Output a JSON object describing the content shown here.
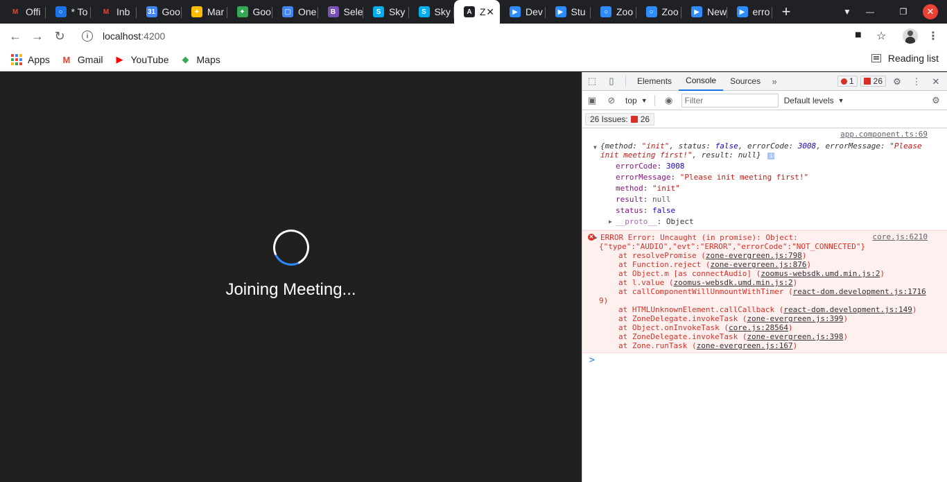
{
  "browser": {
    "tabs": [
      {
        "label": "Offi",
        "icon": "gmail-icon",
        "color": "#ea4335",
        "glyph": "M"
      },
      {
        "label": "* To",
        "icon": "todo-icon",
        "color": "#1a73e8",
        "glyph": "○"
      },
      {
        "label": "Inb",
        "icon": "gmail-icon",
        "color": "#ea4335",
        "glyph": "M"
      },
      {
        "label": "Goo",
        "icon": "calendar-icon",
        "color": "#4285f4",
        "glyph": "31"
      },
      {
        "label": "Mar",
        "icon": "google-photos-icon",
        "color": "#fbbc04",
        "glyph": "✦"
      },
      {
        "label": "Goo",
        "icon": "google-photos-icon",
        "color": "#34a853",
        "glyph": "✦"
      },
      {
        "label": "One",
        "icon": "onedrive-icon",
        "color": "#4285f4",
        "glyph": "▢"
      },
      {
        "label": "Sele",
        "icon": "bootstrap-icon",
        "color": "#7952b3",
        "glyph": "B"
      },
      {
        "label": "Sky",
        "icon": "skype-icon",
        "color": "#00aff0",
        "glyph": "S"
      },
      {
        "label": "Sky",
        "icon": "skype-icon",
        "color": "#00aff0",
        "glyph": "S"
      },
      {
        "label": "Z",
        "icon": "angular-icon",
        "color": "#dd0031",
        "glyph": "A",
        "active": true
      },
      {
        "label": "Dev",
        "icon": "zoom-icon",
        "color": "#2d8cff",
        "glyph": "▶"
      },
      {
        "label": "Stu",
        "icon": "zoom-icon",
        "color": "#2d8cff",
        "glyph": "▶"
      },
      {
        "label": "Zoo",
        "icon": "zoom-round-icon",
        "color": "#2d8cff",
        "glyph": "○"
      },
      {
        "label": "Zoo",
        "icon": "zoom-round-icon",
        "color": "#2d8cff",
        "glyph": "○"
      },
      {
        "label": "New",
        "icon": "zoom-icon",
        "color": "#2d8cff",
        "glyph": "▶"
      },
      {
        "label": "erro",
        "icon": "zoom-icon",
        "color": "#2d8cff",
        "glyph": "▶"
      }
    ],
    "newtab": "+",
    "url_host": "localhost",
    "url_port": ":4200",
    "bookmarks": [
      {
        "label": "Apps",
        "icon": "apps-grid-icon"
      },
      {
        "label": "Gmail",
        "icon": "gmail-icon",
        "glyph": "M",
        "color": "#ea4335"
      },
      {
        "label": "YouTube",
        "icon": "youtube-icon",
        "glyph": "▶",
        "color": "#ff0000"
      },
      {
        "label": "Maps",
        "icon": "maps-icon",
        "glyph": "◆",
        "color": "#34a853"
      }
    ],
    "reading_list": "Reading list"
  },
  "page": {
    "loading_text": "Joining Meeting..."
  },
  "devtools": {
    "tabs": [
      "Elements",
      "Console",
      "Sources"
    ],
    "active_tab": "Console",
    "error_count": "1",
    "issue_count": "26",
    "context": "top",
    "filter_placeholder": "Filter",
    "levels": "Default levels",
    "issues_label": "26 Issues:",
    "issues_count": "26",
    "log": {
      "source": "app.component.ts:69",
      "summary_open": "{method: ",
      "summary_method": "\"init\"",
      "summary_status_key": ", status: ",
      "summary_status": "false",
      "summary_code_key": ", errorCode: ",
      "summary_code": "3008",
      "summary_msg_key": ", errorMessage: ",
      "summary_msg": "\"Please init meeting first!\"",
      "summary_result_key": ", result: ",
      "summary_result": "null}",
      "props": [
        {
          "key": "errorCode",
          "value": "3008",
          "type": "n"
        },
        {
          "key": "errorMessage",
          "value": "\"Please init meeting first!\"",
          "type": "s"
        },
        {
          "key": "method",
          "value": "\"init\"",
          "type": "s"
        },
        {
          "key": "result",
          "value": "null",
          "type": "nl"
        },
        {
          "key": "status",
          "value": "false",
          "type": "n"
        }
      ],
      "proto_key": "__proto__",
      "proto_value": "Object"
    },
    "error": {
      "source": "core.js:6210",
      "line1": "ERROR Error: Uncaught (in promise): Object:",
      "line2": "{\"type\":\"AUDIO\",\"evt\":\"ERROR\",\"errorCode\":\"NOT_CONNECTED\"}",
      "stack": [
        {
          "fn": "at resolvePromise (",
          "loc": "zone-evergreen.js:798",
          "end": ")"
        },
        {
          "fn": "at Function.reject (",
          "loc": "zone-evergreen.js:876",
          "end": ")"
        },
        {
          "fn": "at Object.m [as connectAudio] (",
          "loc": "zoomus-websdk.umd.min.js:2",
          "end": ")"
        },
        {
          "fn": "at l.value (",
          "loc": "zoomus-websdk.umd.min.js:2",
          "end": ")"
        },
        {
          "fn": "at callComponentWillUnmountWithTimer (",
          "loc": "react-dom.development.js:1716",
          "end": ""
        },
        {
          "fn": "",
          "loc": "",
          "end": "9)",
          "wrap": true
        },
        {
          "fn": "at HTMLUnknownElement.callCallback (",
          "loc": "react-dom.development.js:149",
          "end": ")"
        },
        {
          "fn": "at ZoneDelegate.invokeTask (",
          "loc": "zone-evergreen.js:399",
          "end": ")"
        },
        {
          "fn": "at Object.onInvokeTask (",
          "loc": "core.js:28564",
          "end": ")"
        },
        {
          "fn": "at ZoneDelegate.invokeTask (",
          "loc": "zone-evergreen.js:398",
          "end": ")"
        },
        {
          "fn": "at Zone.runTask (",
          "loc": "zone-evergreen.js:167",
          "end": ")"
        }
      ]
    },
    "prompt": ">"
  }
}
